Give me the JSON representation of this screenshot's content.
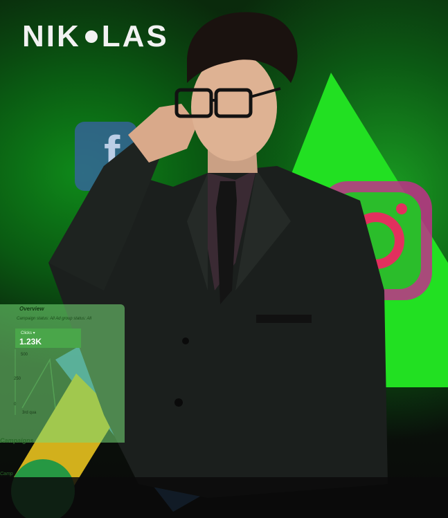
{
  "brand": {
    "left": "NIK",
    "right": "LAS"
  },
  "ads_panel": {
    "tab": "Overview",
    "filter": "Campaign status: All  Ad group status: All",
    "metric_label": "Clicks ▾",
    "metric_value": "1.23K",
    "y_ticks": [
      "500",
      "250",
      "0"
    ],
    "x_label": "3rd qua",
    "section": "Campaigns",
    "footer": "Camp"
  },
  "colors": {
    "green": "#1fd61f",
    "instagram_pink": "#e0308f",
    "facebook_blue": "#3b5998"
  },
  "icons": [
    "facebook-icon",
    "instagram-icon",
    "google-ads-icon"
  ]
}
